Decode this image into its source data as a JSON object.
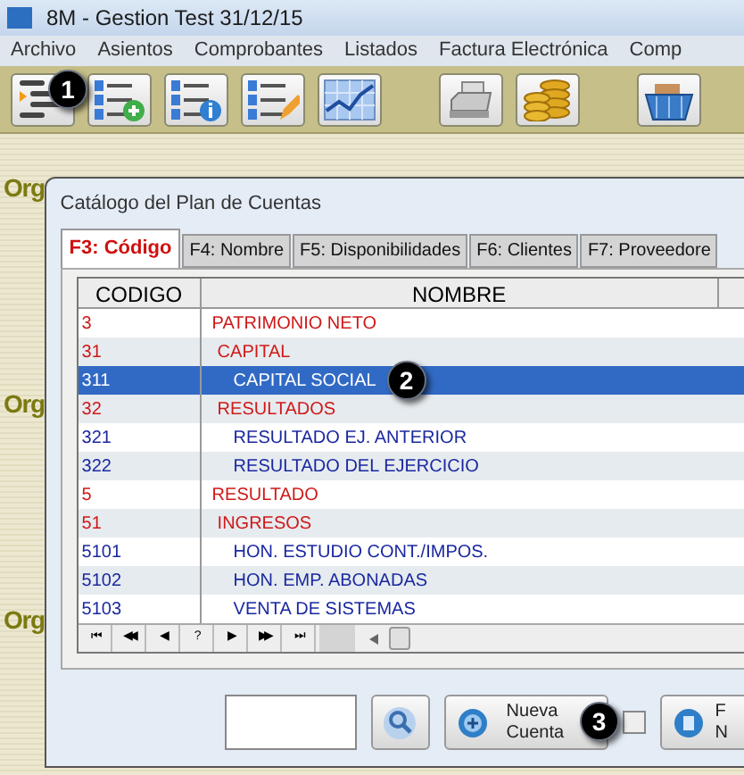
{
  "window": {
    "title": "8M - Gestion Test 31/12/15"
  },
  "menu": [
    "Archivo",
    "Asientos",
    "Comprobantes",
    "Listados",
    "Factura Electrónica",
    "Comp"
  ],
  "toolbar": [
    {
      "kind": "list"
    },
    {
      "kind": "list-add"
    },
    {
      "kind": "list-info"
    },
    {
      "kind": "list-edit"
    },
    {
      "kind": "chart"
    },
    {
      "kind": "gap"
    },
    {
      "kind": "register"
    },
    {
      "kind": "coins"
    },
    {
      "kind": "gap"
    },
    {
      "kind": "basket"
    }
  ],
  "background_labels": [
    "Org",
    "Org",
    "Org"
  ],
  "dialog": {
    "title": "Catálogo del Plan de Cuentas",
    "tabs": [
      {
        "label": "F3: Código",
        "selected": true
      },
      {
        "label": "F4: Nombre",
        "selected": false
      },
      {
        "label": "F5: Disponibilidades",
        "selected": false
      },
      {
        "label": "F6: Clientes",
        "selected": false
      },
      {
        "label": "F7: Proveedore",
        "selected": false
      }
    ],
    "columns": [
      "CODIGO",
      "NOMBRE"
    ],
    "rows": [
      {
        "code": "3",
        "name": "PATRIMONIO NETO",
        "kind": "group",
        "selected": false,
        "children": [
          {
            "code": "31",
            "name": "CAPITAL",
            "kind": "group",
            "selected": false,
            "children": [
              {
                "code": "311",
                "name": "CAPITAL SOCIAL",
                "kind": "account",
                "selected": true
              }
            ]
          },
          {
            "code": "32",
            "name": "RESULTADOS",
            "kind": "group",
            "selected": false,
            "children": [
              {
                "code": "321",
                "name": "RESULTADO EJ. ANTERIOR",
                "kind": "account",
                "selected": false
              },
              {
                "code": "322",
                "name": "RESULTADO DEL EJERCICIO",
                "kind": "account",
                "selected": false
              }
            ]
          }
        ]
      },
      {
        "code": "5",
        "name": "RESULTADO",
        "kind": "group",
        "selected": false,
        "children": [
          {
            "code": "51",
            "name": "INGRESOS",
            "kind": "group",
            "selected": false,
            "children": [
              {
                "code": "5101",
                "name": "HON. ESTUDIO CONT./IMPOS.",
                "kind": "account",
                "selected": false
              },
              {
                "code": "5102",
                "name": "HON. EMP. ABONADAS",
                "kind": "account",
                "selected": false
              },
              {
                "code": "5103",
                "name": "VENTA DE SISTEMAS",
                "kind": "account",
                "selected": false
              }
            ]
          }
        ]
      }
    ],
    "navigator": [
      "⏮",
      "◀◀",
      "◀",
      "?",
      "▶",
      "▶▶",
      "⏭"
    ],
    "new_account_button": [
      "Nueva",
      "Cuenta"
    ],
    "checkbox": {
      "checked": false
    },
    "last_button": [
      "F",
      "N"
    ]
  },
  "callouts": [
    "1",
    "2",
    "3"
  ]
}
